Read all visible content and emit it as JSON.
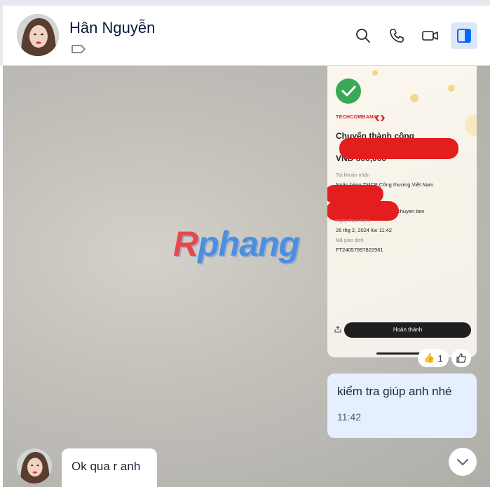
{
  "header": {
    "contact_name": "Hân Nguyễn",
    "icons": [
      "search-icon",
      "phone-icon",
      "video-call-icon",
      "sidebar-toggle-icon"
    ]
  },
  "watermark": {
    "text_a": "R",
    "text_b": "phang"
  },
  "receipt": {
    "bank": "TECHCOMBANK",
    "title": "Chuyển thành công",
    "amount": "VND 600,000",
    "recipient_label": "Tài khoản nhận",
    "recipient_bank": "Ngân hàng TMCP Công thương Việt Nam",
    "note_fragment": "chuyen tien",
    "time_label": "Ngày thực hiện",
    "time_value": "26 thg 2, 2024 lúc 11:42",
    "txn_label": "Mã giao dịch",
    "txn_value": "FT24057997822961",
    "done_label": "Hoàn thành",
    "colors": {
      "success": "#3aa957",
      "redaction": "#e41e1e",
      "brand": "#d6212b"
    }
  },
  "reaction": {
    "emoji": "👍",
    "count": "1"
  },
  "messages": {
    "outgoing": {
      "text": "kiểm tra giúp anh nhé",
      "time": "11:42"
    },
    "incoming": {
      "text": "Ok qua r anh"
    }
  }
}
